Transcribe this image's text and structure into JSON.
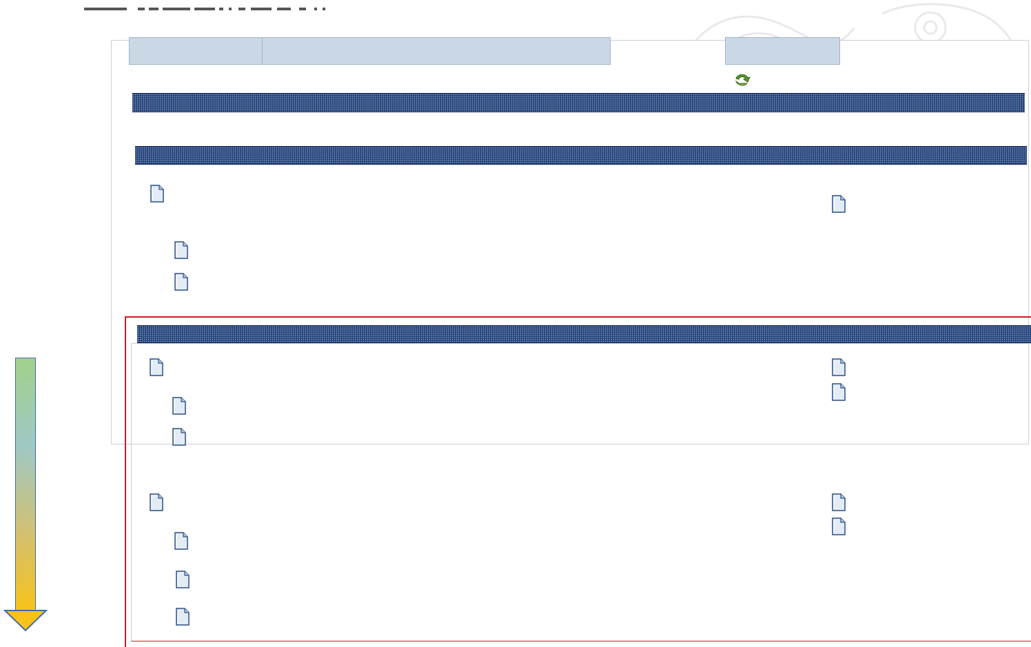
{
  "header": {
    "caption": ""
  },
  "tabs": [
    {
      "id": "tab-1",
      "label": ""
    },
    {
      "id": "tab-2",
      "label": ""
    },
    {
      "id": "tab-3",
      "label": ""
    }
  ],
  "icons": {
    "back": "refresh-arrow-icon",
    "document": "document-icon",
    "scroll_arrow": "arrow-down-icon"
  },
  "colors": {
    "section_bar": "#1f3f79",
    "tab_fill": "#cad8e6",
    "highlight": "#d4161f",
    "back_icon": "#4a8a2a"
  },
  "sections": [
    {
      "name": "section-1",
      "title": "",
      "rows": []
    },
    {
      "name": "section-2",
      "title": "",
      "rows": [
        {
          "name": "doc-item",
          "label": ""
        },
        {
          "name": "doc-item",
          "label": ""
        },
        {
          "name": "doc-item",
          "label": ""
        },
        {
          "name": "doc-item",
          "label": ""
        }
      ]
    },
    {
      "name": "section-3",
      "title": "",
      "rows": [
        {
          "name": "doc-item",
          "label": ""
        },
        {
          "name": "doc-item",
          "label": ""
        },
        {
          "name": "doc-item",
          "label": ""
        },
        {
          "name": "doc-item",
          "label": ""
        },
        {
          "name": "doc-item",
          "label": ""
        },
        {
          "name": "doc-item",
          "label": ""
        },
        {
          "name": "doc-item",
          "label": ""
        },
        {
          "name": "doc-item",
          "label": ""
        },
        {
          "name": "doc-item",
          "label": ""
        },
        {
          "name": "doc-item",
          "label": ""
        }
      ]
    }
  ]
}
